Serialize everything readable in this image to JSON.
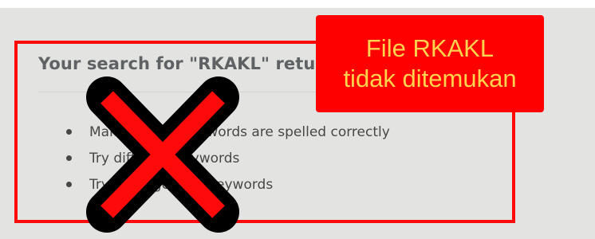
{
  "search_result": {
    "heading": "Your search for \"RKAKL\" returned no results",
    "tips": [
      "Make sure all keywords are spelled correctly",
      "Try different keywords",
      "Try more general keywords"
    ]
  },
  "callout": {
    "line1": "File RKAKL",
    "line2": "tidak ditemukan"
  },
  "icons": {
    "x_mark": "cross-icon"
  },
  "colors": {
    "highlight_border": "#ff0a0a",
    "callout_background": "#ff0000",
    "callout_text": "#ffd34d",
    "panel_background": "#e3e3e1"
  }
}
